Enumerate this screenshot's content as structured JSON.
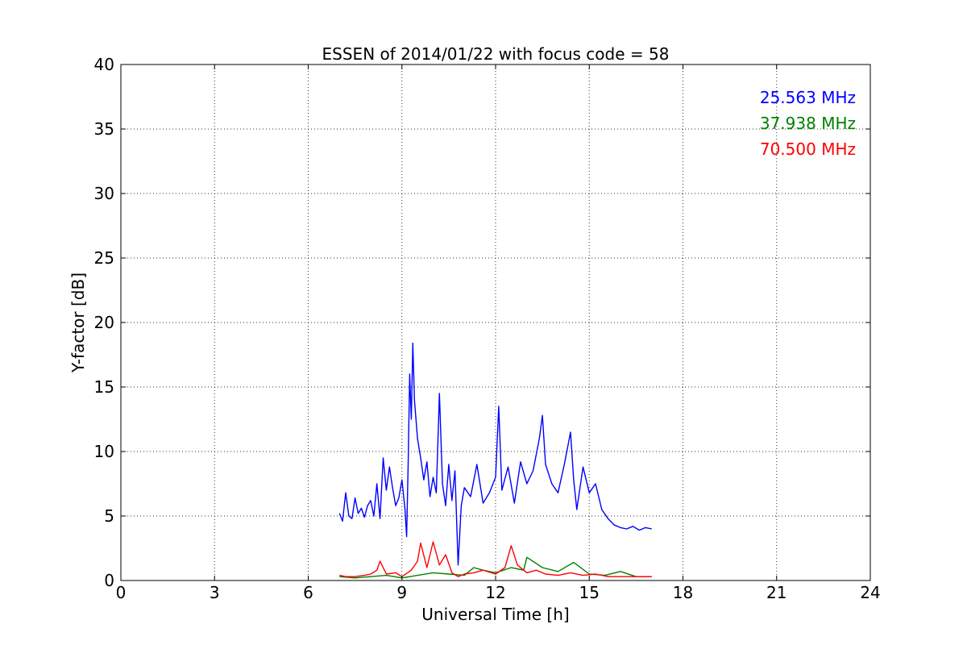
{
  "chart_data": {
    "type": "line",
    "title": "ESSEN of 2014/01/22 with focus code = 58",
    "xlabel": "Universal Time [h]",
    "ylabel": "Y-factor [dB]",
    "xlim": [
      0,
      24
    ],
    "ylim": [
      0,
      40
    ],
    "xticks": [
      0,
      3,
      6,
      9,
      12,
      15,
      18,
      21,
      24
    ],
    "yticks": [
      0,
      5,
      10,
      15,
      20,
      25,
      30,
      35,
      40
    ],
    "grid": true,
    "legend": "top-right",
    "series": [
      {
        "name": "25.563 MHz",
        "color": "#0000ff",
        "x": [
          7.0,
          7.1,
          7.2,
          7.3,
          7.4,
          7.5,
          7.6,
          7.7,
          7.8,
          7.9,
          8.0,
          8.1,
          8.2,
          8.3,
          8.4,
          8.5,
          8.6,
          8.7,
          8.8,
          8.9,
          9.0,
          9.1,
          9.15,
          9.2,
          9.25,
          9.3,
          9.35,
          9.4,
          9.5,
          9.6,
          9.7,
          9.8,
          9.9,
          10.0,
          10.1,
          10.2,
          10.3,
          10.4,
          10.5,
          10.6,
          10.7,
          10.8,
          10.9,
          11.0,
          11.2,
          11.4,
          11.6,
          11.8,
          12.0,
          12.1,
          12.2,
          12.4,
          12.6,
          12.8,
          13.0,
          13.2,
          13.4,
          13.5,
          13.6,
          13.8,
          14.0,
          14.2,
          14.4,
          14.5,
          14.6,
          14.8,
          15.0,
          15.2,
          15.4,
          15.6,
          15.8,
          16.0,
          16.2,
          16.4,
          16.6,
          16.8,
          17.0
        ],
        "y": [
          5.2,
          4.6,
          6.8,
          5.0,
          4.8,
          6.4,
          5.2,
          5.6,
          4.9,
          5.8,
          6.2,
          5.0,
          7.5,
          4.8,
          9.5,
          7.0,
          8.8,
          7.2,
          5.8,
          6.4,
          7.8,
          5.5,
          3.4,
          9.0,
          16.0,
          12.5,
          18.4,
          14.0,
          11.0,
          9.5,
          7.8,
          9.2,
          6.5,
          8.0,
          6.8,
          14.5,
          7.5,
          5.8,
          9.0,
          6.2,
          8.5,
          1.2,
          5.8,
          7.2,
          6.5,
          9.0,
          6.0,
          6.8,
          8.0,
          13.5,
          7.0,
          8.8,
          6.0,
          9.2,
          7.5,
          8.5,
          11.0,
          12.8,
          9.0,
          7.5,
          6.8,
          9.0,
          11.5,
          7.8,
          5.5,
          8.8,
          6.8,
          7.5,
          5.5,
          4.8,
          4.3,
          4.1,
          4.0,
          4.2,
          3.9,
          4.1,
          4.0
        ]
      },
      {
        "name": "37.938 MHz",
        "color": "#008000",
        "x": [
          7.0,
          7.5,
          8.0,
          8.5,
          9.0,
          9.5,
          10.0,
          10.5,
          11.0,
          11.3,
          11.6,
          12.0,
          12.5,
          12.9,
          13.0,
          13.5,
          14.0,
          14.5,
          15.0,
          15.5,
          16.0,
          16.5,
          17.0
        ],
        "y": [
          0.3,
          0.2,
          0.3,
          0.4,
          0.2,
          0.4,
          0.6,
          0.5,
          0.4,
          1.0,
          0.8,
          0.6,
          1.0,
          0.8,
          1.8,
          1.0,
          0.7,
          1.4,
          0.5,
          0.4,
          0.7,
          0.3,
          0.3
        ]
      },
      {
        "name": "70.500 MHz",
        "color": "#ff0000",
        "x": [
          7.0,
          7.2,
          7.5,
          7.8,
          8.0,
          8.2,
          8.3,
          8.5,
          8.8,
          9.0,
          9.3,
          9.5,
          9.6,
          9.8,
          10.0,
          10.2,
          10.4,
          10.6,
          10.8,
          11.0,
          11.3,
          11.6,
          12.0,
          12.3,
          12.5,
          12.7,
          13.0,
          13.3,
          13.6,
          14.0,
          14.4,
          14.8,
          15.2,
          15.6,
          16.0,
          16.5,
          17.0
        ],
        "y": [
          0.4,
          0.3,
          0.3,
          0.4,
          0.5,
          0.8,
          1.5,
          0.5,
          0.6,
          0.3,
          0.8,
          1.5,
          2.9,
          1.0,
          3.0,
          1.2,
          2.0,
          0.6,
          0.3,
          0.5,
          0.6,
          0.8,
          0.5,
          1.0,
          2.7,
          1.2,
          0.6,
          0.8,
          0.5,
          0.4,
          0.6,
          0.4,
          0.5,
          0.3,
          0.3,
          0.3,
          0.3
        ]
      }
    ]
  }
}
